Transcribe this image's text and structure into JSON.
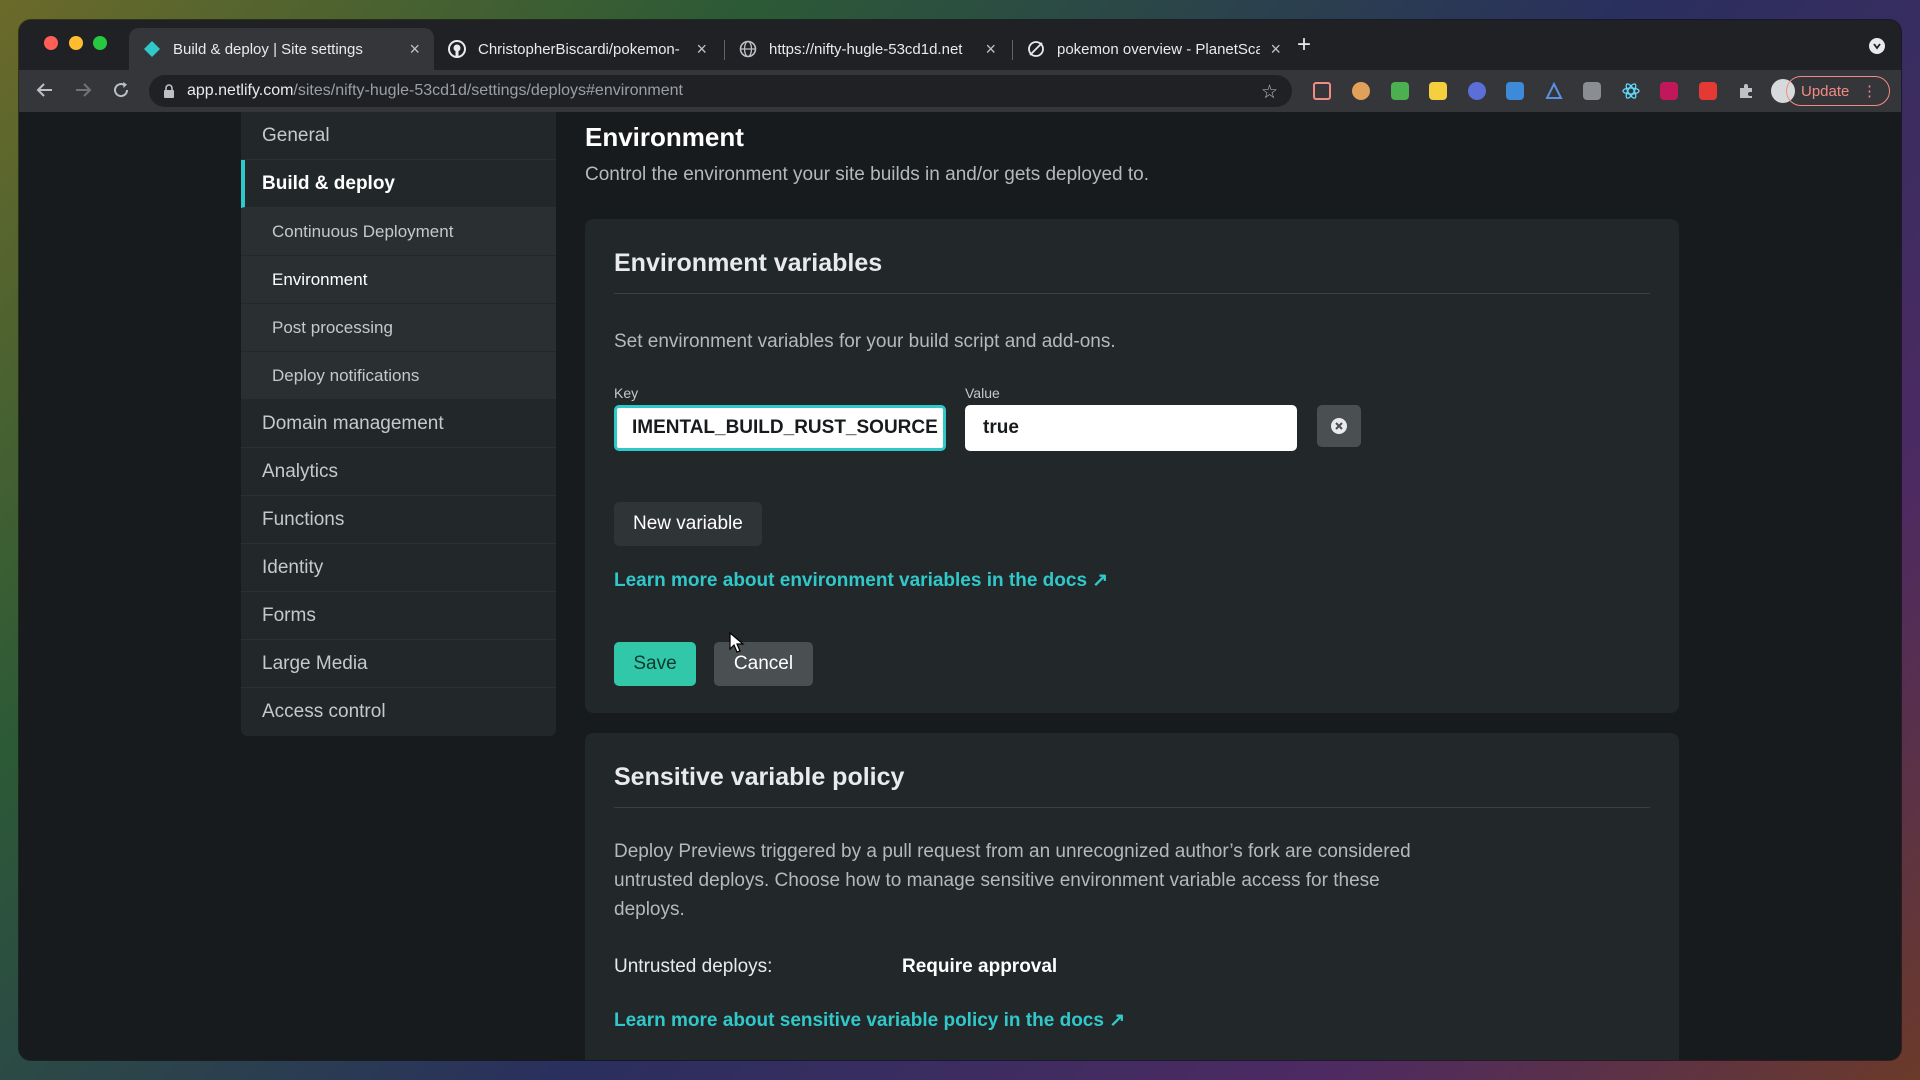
{
  "browser": {
    "tabs": [
      {
        "title": "Build & deploy | Site settings",
        "icon": "netlify-icon",
        "active": true
      },
      {
        "title": "ChristopherBiscardi/pokemon-",
        "icon": "github-icon"
      },
      {
        "title": "https://nifty-hugle-53cd1d.net",
        "icon": "globe-icon"
      },
      {
        "title": "pokemon overview - PlanetSca",
        "icon": "planetscale-icon"
      }
    ],
    "url_host": "app.netlify.com",
    "url_path": "/sites/nifty-hugle-53cd1d/settings/deploys#environment",
    "update_label": "Update"
  },
  "sidebar": {
    "items": [
      {
        "label": "General"
      },
      {
        "label": "Build & deploy",
        "active": true
      },
      {
        "label": "Continuous Deployment",
        "sub": true
      },
      {
        "label": "Environment",
        "sub": true,
        "active": true
      },
      {
        "label": "Post processing",
        "sub": true
      },
      {
        "label": "Deploy notifications",
        "sub": true
      },
      {
        "label": "Domain management"
      },
      {
        "label": "Analytics"
      },
      {
        "label": "Functions"
      },
      {
        "label": "Identity"
      },
      {
        "label": "Forms"
      },
      {
        "label": "Large Media"
      },
      {
        "label": "Access control"
      }
    ]
  },
  "main": {
    "heading": "Environment",
    "description": "Control the environment your site builds in and/or gets deployed to.",
    "env_vars": {
      "title": "Environment variables",
      "description": "Set environment variables for your build script and add-ons.",
      "key_label": "Key",
      "key_value": "IMENTAL_BUILD_RUST_SOURCE",
      "value_label": "Value",
      "value_value": "true",
      "new_variable_label": "New variable",
      "docs_link": "Learn more about environment variables in the docs ↗",
      "save_label": "Save",
      "cancel_label": "Cancel"
    },
    "sensitive": {
      "title": "Sensitive variable policy",
      "description": "Deploy Previews triggered by a pull request from an unrecognized author’s fork are considered untrusted deploys. Choose how to manage sensitive environment variable access for these deploys.",
      "untrusted_label": "Untrusted deploys:",
      "untrusted_value": "Require approval",
      "docs_link": "Learn more about sensitive variable policy in the docs ↗"
    }
  },
  "colors": {
    "accent": "#30c8c9",
    "save_button": "#30c8a9",
    "page_bg": "#181b1d",
    "card_bg": "#22272a"
  }
}
